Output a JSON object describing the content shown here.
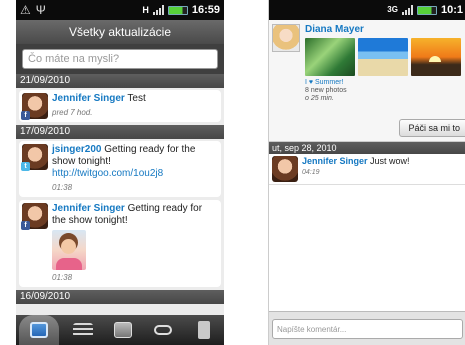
{
  "left": {
    "status": {
      "network": "H",
      "time": "16:59"
    },
    "title": "Všetky aktualizácie",
    "composer_placeholder": "Čo máte na mysli?",
    "groups": [
      {
        "date": "21/09/2010"
      },
      {
        "date": "17/09/2010"
      },
      {
        "date": "16/09/2010"
      }
    ],
    "posts": [
      {
        "author": "Jennifer Singer",
        "text": "Test",
        "time": "pred 7 hod.",
        "source": "facebook"
      },
      {
        "author": "jsinger200",
        "text": "Getting ready for the show tonight!",
        "link": "http://twitgoo.com/1ou2j8",
        "time": "01:38",
        "source": "twitter"
      },
      {
        "author": "Jennifer Singer",
        "text": "Getting ready for the show tonight!",
        "time": "01:38",
        "source": "facebook"
      }
    ],
    "tabs": [
      "home-icon",
      "messages-icon",
      "photos-icon",
      "links-icon",
      "profile-icon"
    ]
  },
  "right": {
    "status": {
      "network": "3G",
      "time": "10:1"
    },
    "author": "Diana Mayer",
    "caption": "I ♥ Summer!",
    "photo_count": "8 new photos",
    "ago": "o 25 min.",
    "like_label": "Páči sa mi to",
    "date": "ut, sep 28, 2010",
    "comment": {
      "author": "Jennifer Singer",
      "text": "Just wow!",
      "time": "04:19"
    },
    "comment_placeholder": "Napíšte komentár..."
  },
  "colors": {
    "accent_link": "#1679c2",
    "facebook": "#3b5998",
    "twitter": "#4cb8e8",
    "battery": "#57d13a"
  }
}
